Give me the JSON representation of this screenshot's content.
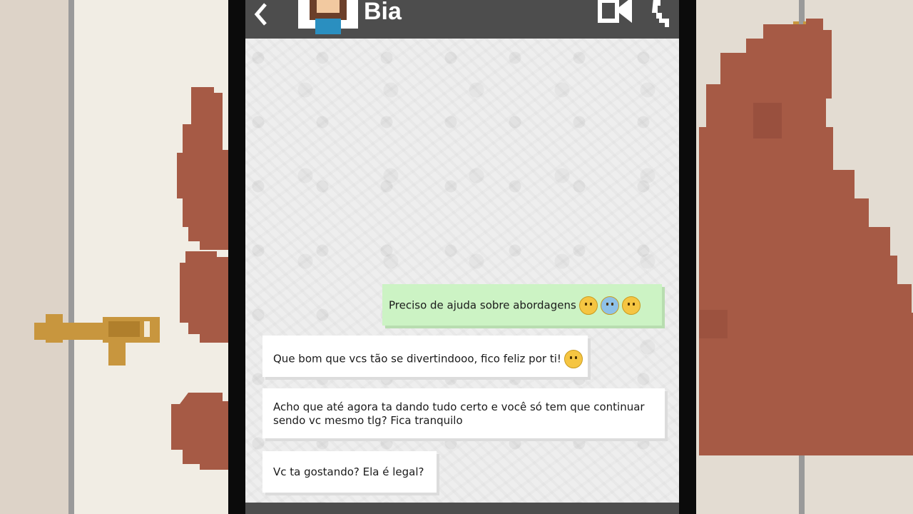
{
  "chat_header": {
    "back_icon": "chevron-left-icon",
    "contact_name": "Bia",
    "avatar_icon": "girl-avatar-icon",
    "video_icon": "video-call-icon",
    "call_icon": "phone-call-icon"
  },
  "messages": [
    {
      "direction": "outgoing",
      "text": "Preciso de ajuda sobre abordagens",
      "emojis": [
        "worried-face-emoji",
        "screaming-face-emoji",
        "shushing-face-emoji"
      ]
    },
    {
      "direction": "incoming",
      "text": "Que bom que vcs tão se divertindooo, fico feliz por ti!",
      "emojis": [
        "pleading-face-emoji"
      ]
    },
    {
      "direction": "incoming",
      "text": "Acho que até agora ta dando tudo certo e você só tem que continuar sendo vc mesmo tlg? Fica tranquilo",
      "emojis": []
    },
    {
      "direction": "incoming",
      "text": "Vc ta gostando? Ela é legal?",
      "emojis": []
    }
  ],
  "colors": {
    "header": "#4d4d4d",
    "outgoing_bubble": "#ccf3c4",
    "incoming_bubble": "#ffffff",
    "hand": "#a65a45",
    "door_latch": "#c8963e"
  }
}
